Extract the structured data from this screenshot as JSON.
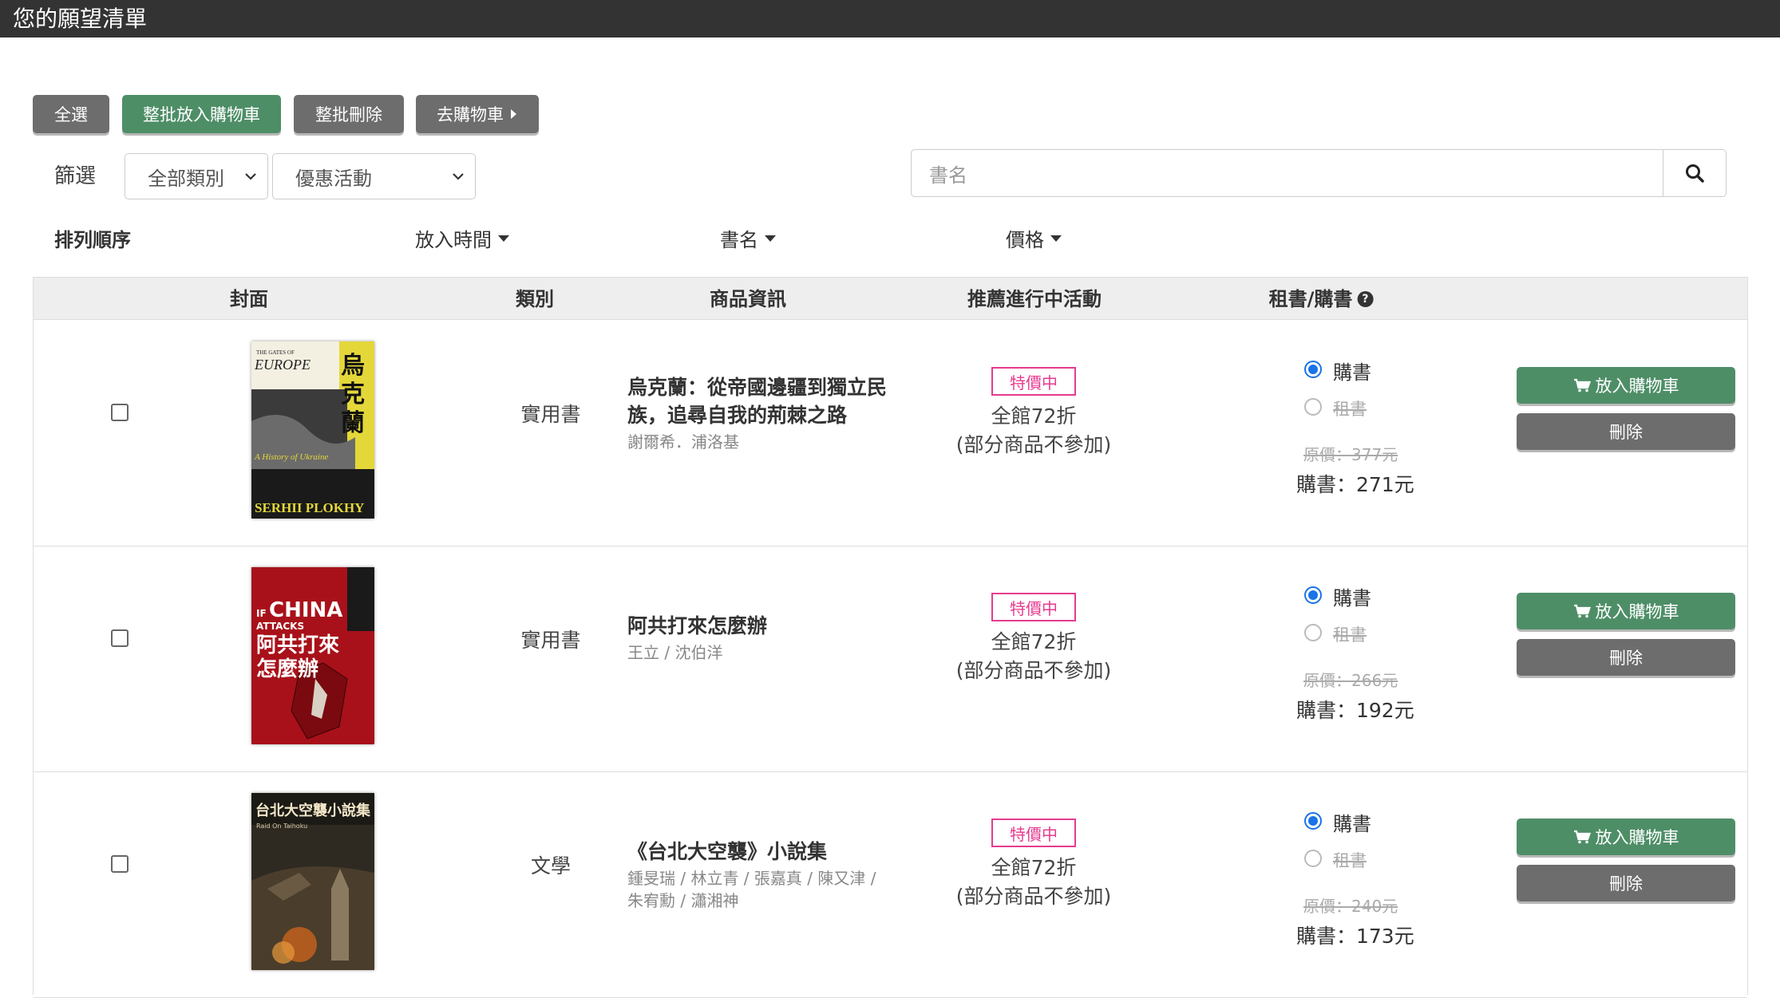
{
  "header": {
    "title": "您的願望清單"
  },
  "toolbar": {
    "select_all": "全選",
    "bulk_add_cart": "整批放入購物車",
    "bulk_delete": "整批刪除",
    "go_cart": "去購物車"
  },
  "filter": {
    "label": "篩選",
    "category": "全部類別",
    "promotion": "優惠活動",
    "search_placeholder": "書名"
  },
  "sort": {
    "label": "排列順序",
    "by_time": "放入時間",
    "by_title": "書名",
    "by_price": "價格"
  },
  "table": {
    "headers": {
      "cover": "封面",
      "category": "類別",
      "info": "商品資訊",
      "promo": "推薦進行中活動",
      "rent_buy": "租書/購書"
    },
    "rows": [
      {
        "category": "實用書",
        "title": "烏克蘭：從帝國邊疆到獨立民族，追尋自我的荊棘之路",
        "author": "謝爾希．浦洛基",
        "badge": "特價中",
        "promo_line1": "全館72折",
        "promo_line2": "(部分商品不參加)",
        "buy_label": "購書",
        "rent_label": "租書",
        "original_price": "原價：377元",
        "buy_price": "購書：271元",
        "add_cart": "放入購物車",
        "delete": "刪除",
        "cover_text": {
          "top": "THE GATES OF",
          "main": "EUROPE",
          "cjk": "烏克蘭",
          "sub": "A History of Ukraine",
          "author": "SERHII PLOKHY"
        }
      },
      {
        "category": "實用書",
        "title": "阿共打來怎麼辦",
        "author": "王立 / 沈伯洋",
        "badge": "特價中",
        "promo_line1": "全館72折",
        "promo_line2": "(部分商品不參加)",
        "buy_label": "購書",
        "rent_label": "租書",
        "original_price": "原價：266元",
        "buy_price": "購書：192元",
        "add_cart": "放入購物車",
        "delete": "刪除",
        "cover_text": {
          "en1": "IF",
          "en2": "CHINA",
          "en3": "ATTACKS",
          "cjk1": "阿共打來",
          "cjk2": "怎麼辦"
        }
      },
      {
        "category": "文學",
        "title": "《台北大空襲》小說集",
        "author": "鍾旻瑞 / 林立青 / 張嘉真 / 陳又津 / 朱宥勳 / 瀟湘神",
        "badge": "特價中",
        "promo_line1": "全館72折",
        "promo_line2": "(部分商品不參加)",
        "buy_label": "購書",
        "rent_label": "租書",
        "original_price": "原價：240元",
        "buy_price": "購書：173元",
        "add_cart": "放入購物車",
        "delete": "刪除",
        "cover_text": {
          "cjk": "台北大空襲小說集",
          "en": "Raid On Taihoku"
        }
      }
    ]
  },
  "colors": {
    "header_bg": "#333333",
    "green": "#4e8e67",
    "gray": "#6d6d6d",
    "badge": "#e63b8f",
    "radio": "#1a73e8"
  }
}
